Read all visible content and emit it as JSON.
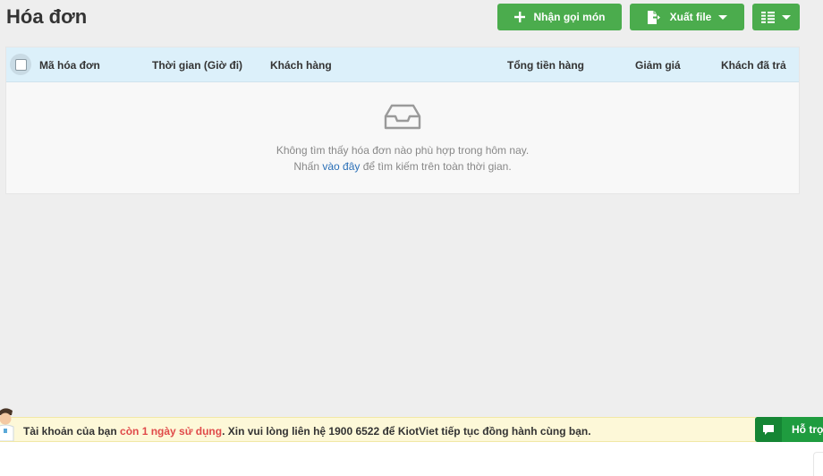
{
  "page": {
    "title": "Hóa đơn"
  },
  "toolbar": {
    "order_label": "Nhận gọi món",
    "export_label": "Xuất file",
    "order_icon": "plus-icon",
    "export_icon": "file-export-icon",
    "columns_icon": "column-list-icon"
  },
  "table": {
    "columns": [
      "Mã hóa đơn",
      "Thời gian (Giờ đi)",
      "Khách hàng",
      "Tổng tiền hàng",
      "Giảm giá",
      "Khách đã trả"
    ],
    "empty_icon": "empty-tray-icon",
    "empty_line1": "Không tìm thấy hóa đơn nào phù hợp trong hôm nay.",
    "empty_line2_prefix": "Nhấn ",
    "empty_line2_link": "vào đây",
    "empty_line2_suffix": " để tìm kiếm trên toàn thời gian."
  },
  "notice": {
    "prefix": "Tài khoản của bạn ",
    "highlight": "còn 1 ngày sử dụng",
    "suffix": ". Xin vui lòng liên hệ 1900 6522 để KiotViet tiếp tục đồng hành cùng bạn."
  },
  "support": {
    "label": "Hỗ trợ"
  },
  "colors": {
    "primary_green": "#4bac4d",
    "header_blue": "#dcf0fa",
    "notice_bg": "#fdf8d8",
    "highlight_red": "#e04a4a",
    "link_blue": "#2a6fb7"
  }
}
